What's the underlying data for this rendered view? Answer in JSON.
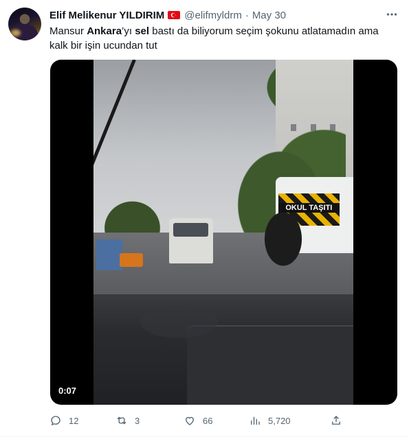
{
  "author": {
    "name": "Elif Melikenur YILDIRIM",
    "handle": "@elifmyldrm",
    "separator": "·",
    "date": "May 30",
    "flag_icon": "turkey-flag-icon"
  },
  "tweet": {
    "text_parts": [
      "Mansur ",
      "Ankara",
      "’yı ",
      "sel",
      " bastı da biliyorum seçim şokunu atlatamadın ama kalk bir işin ucundan tut"
    ]
  },
  "media": {
    "type": "video",
    "timestamp": "0:07",
    "sign_text": "OKUL TAŞITI"
  },
  "actions": {
    "reply_count": "12",
    "retweet_count": "3",
    "like_count": "66",
    "view_count": "5,720"
  },
  "colors": {
    "text": "#0f1419",
    "muted": "#536471",
    "flag": "#e30a17"
  }
}
